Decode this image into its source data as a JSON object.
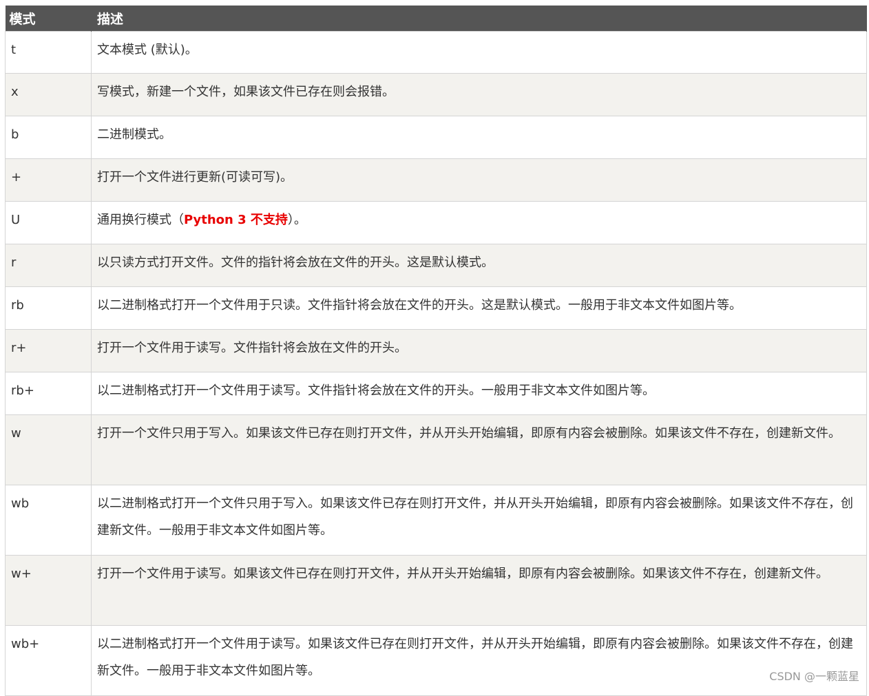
{
  "header": {
    "col_mode": "模式",
    "col_desc": "描述"
  },
  "rows": [
    {
      "mode": "t",
      "desc": "文本模式 (默认)。"
    },
    {
      "mode": "x",
      "desc": "写模式，新建一个文件，如果该文件已存在则会报错。"
    },
    {
      "mode": "b",
      "desc": "二进制模式。"
    },
    {
      "mode": "+",
      "desc": "打开一个文件进行更新(可读可写)。"
    },
    {
      "mode": "U",
      "desc_prefix": "通用换行模式（",
      "desc_highlight": "Python 3 不支持",
      "desc_suffix": "）。"
    },
    {
      "mode": "r",
      "desc": "以只读方式打开文件。文件的指针将会放在文件的开头。这是默认模式。"
    },
    {
      "mode": "rb",
      "desc": "以二进制格式打开一个文件用于只读。文件指针将会放在文件的开头。这是默认模式。一般用于非文本文件如图片等。"
    },
    {
      "mode": "r+",
      "desc": "打开一个文件用于读写。文件指针将会放在文件的开头。"
    },
    {
      "mode": "rb+",
      "desc": "以二进制格式打开一个文件用于读写。文件指针将会放在文件的开头。一般用于非文本文件如图片等。"
    },
    {
      "mode": "w",
      "desc": "打开一个文件只用于写入。如果该文件已存在则打开文件，并从开头开始编辑，即原有内容会被删除。如果该文件不存在，创建新文件。"
    },
    {
      "mode": "wb",
      "desc": "以二进制格式打开一个文件只用于写入。如果该文件已存在则打开文件，并从开头开始编辑，即原有内容会被删除。如果该文件不存在，创建新文件。一般用于非文本文件如图片等。"
    },
    {
      "mode": "w+",
      "desc": "打开一个文件用于读写。如果该文件已存在则打开文件，并从开头开始编辑，即原有内容会被删除。如果该文件不存在，创建新文件。"
    },
    {
      "mode": "wb+",
      "desc": "以二进制格式打开一个文件用于读写。如果该文件已存在则打开文件，并从开头开始编辑，即原有内容会被删除。如果该文件不存在，创建新文件。一般用于非文本文件如图片等。"
    }
  ],
  "watermark": "CSDN @一颗蓝星",
  "colors": {
    "header_bg": "#555555",
    "stripe": "#f3f2ee",
    "highlight": "#e80000"
  }
}
